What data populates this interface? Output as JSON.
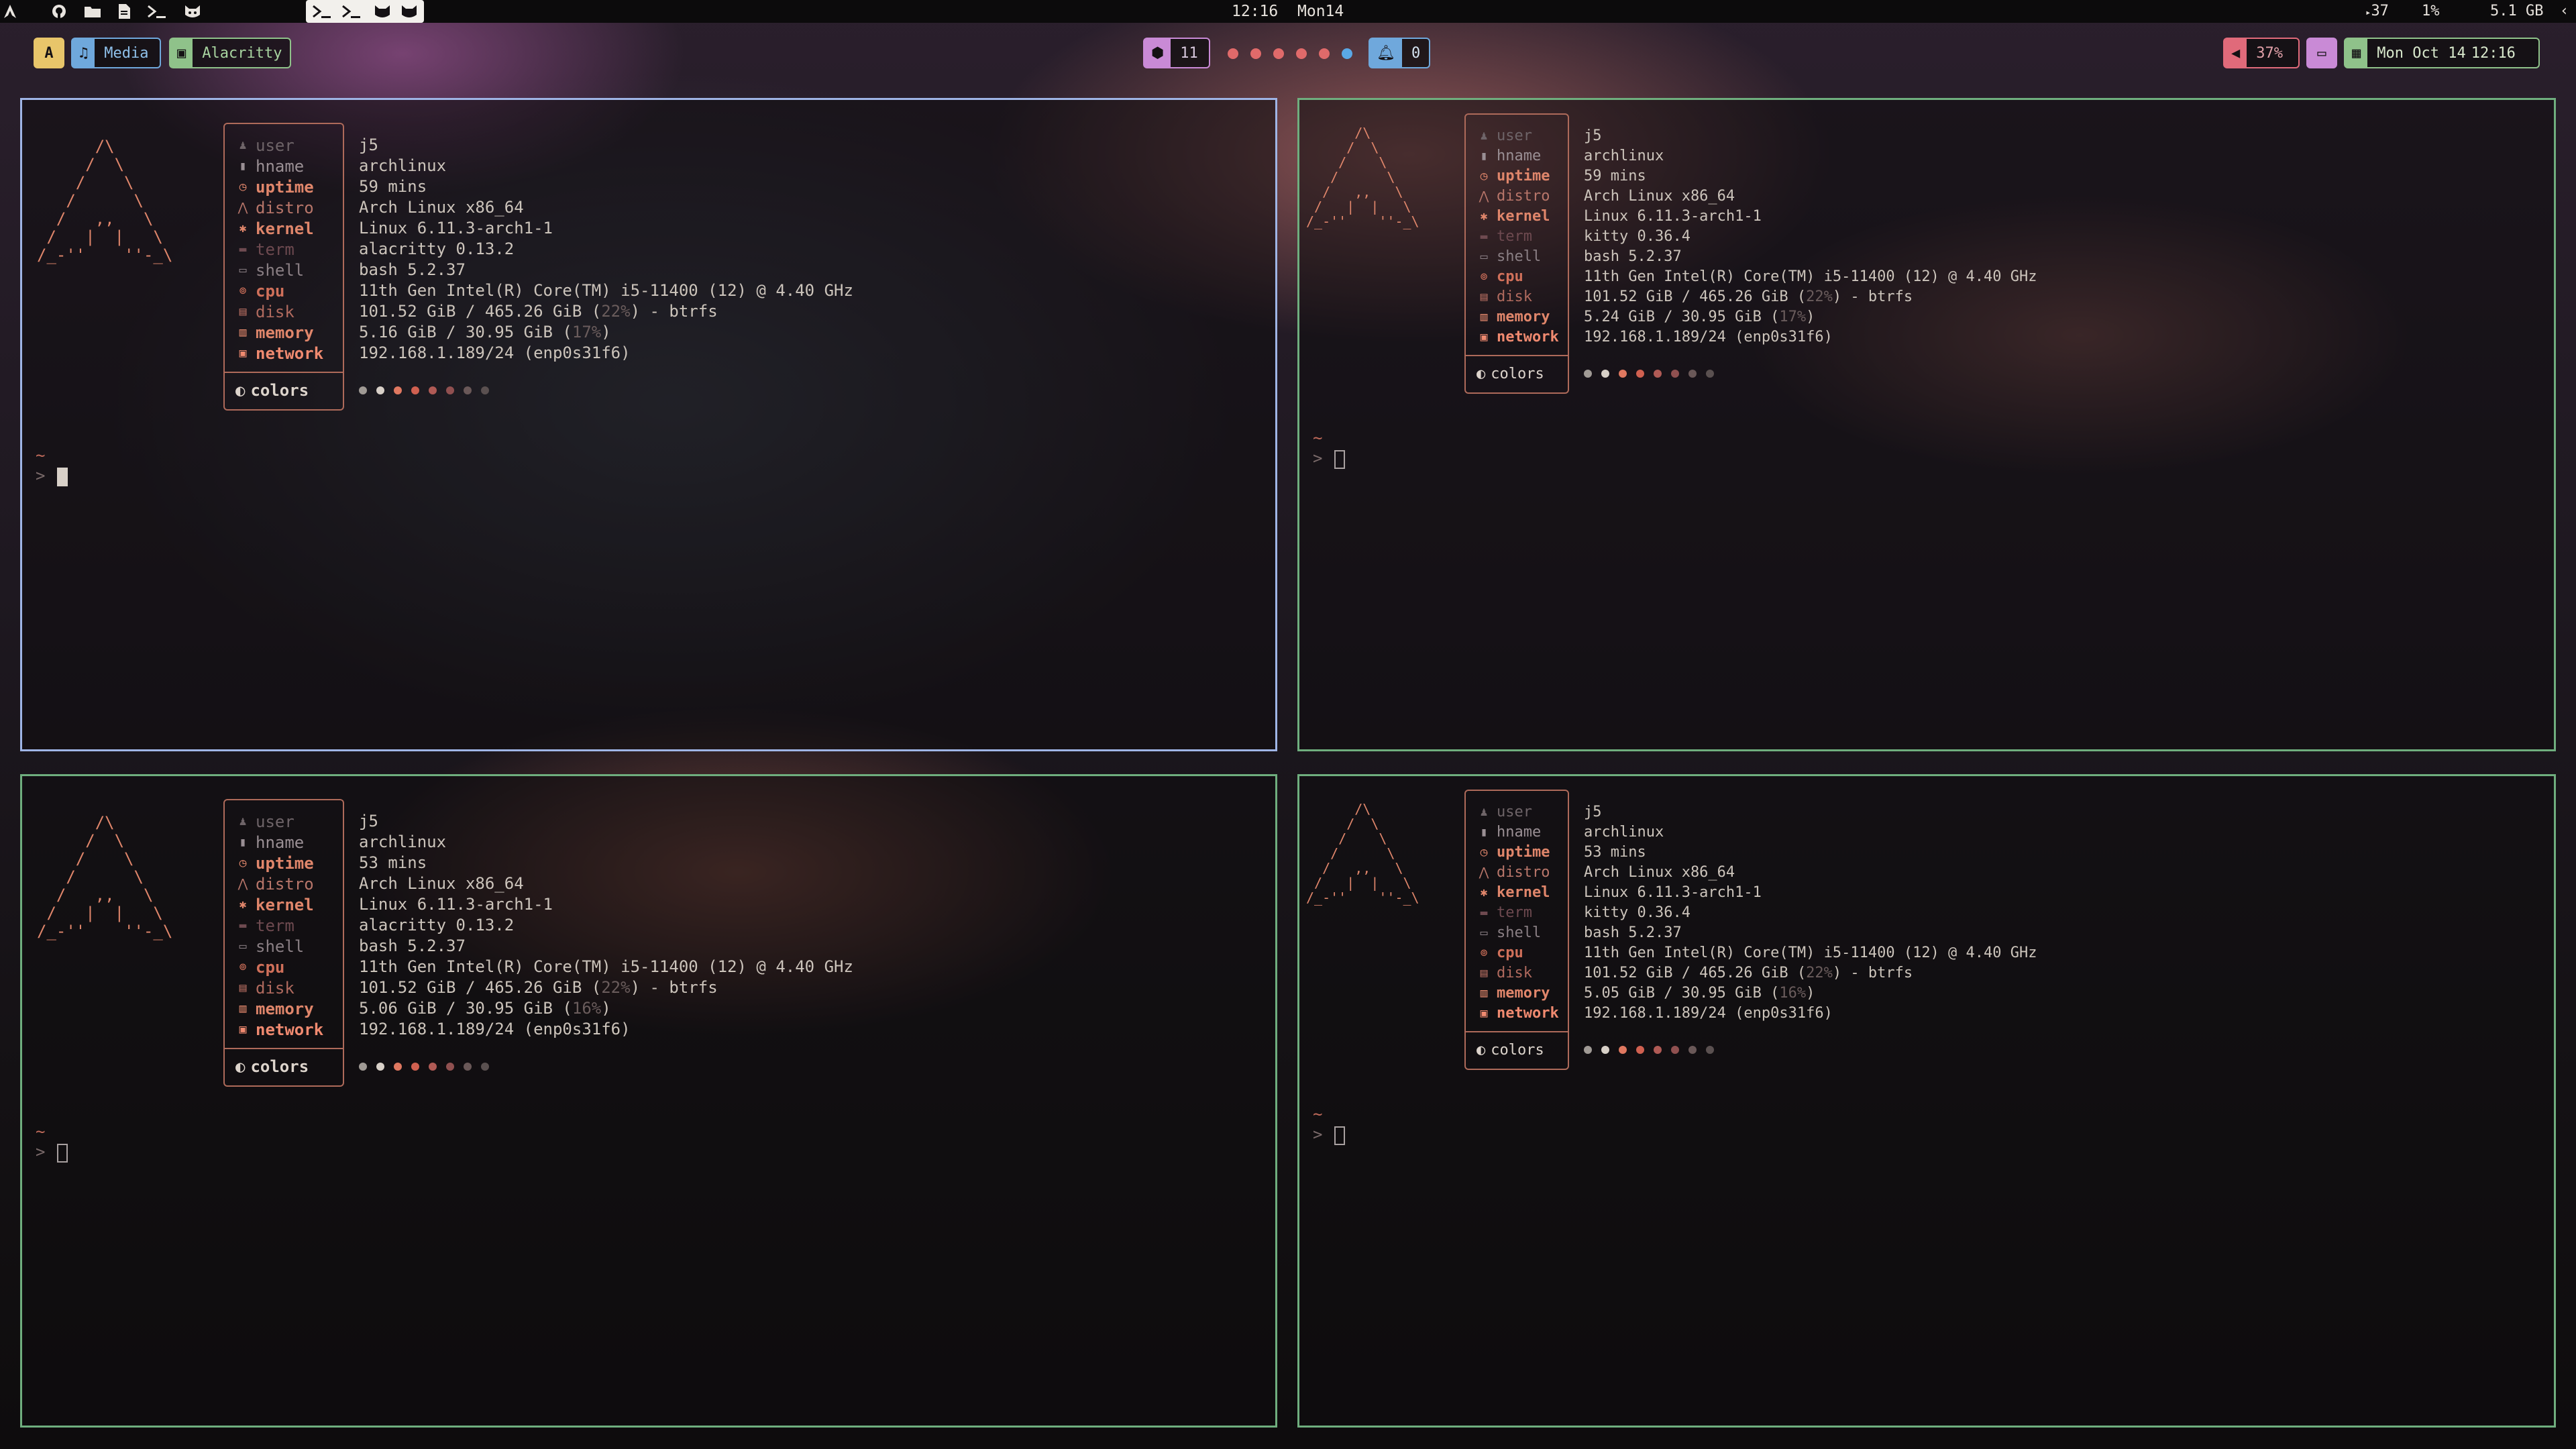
{
  "topbar": {
    "launcher_icons": [
      "arch-icon",
      "github-icon",
      "folder-icon",
      "file-icon",
      "terminal-icon",
      "cat-icon"
    ],
    "active_workspace_icons": [
      "terminal-icon",
      "terminal-icon",
      "cat-icon",
      "cat-icon"
    ],
    "center_time": "12:16",
    "center_date": "Mon14",
    "temp": "37",
    "cpu": "1%",
    "mem": "5.1 GB",
    "expand": "‹"
  },
  "modules": {
    "arch_label": "A",
    "media_label": "Media",
    "window_label": "Alacritty",
    "updates_count": "11",
    "notifications_count": "0",
    "volume": "37%",
    "clock_date": "Mon Oct 14",
    "clock_time": "12:16"
  },
  "workspace_dots": [
    "#e06a6a",
    "#e06a6a",
    "#e06a6a",
    "#e06a6a",
    "#e06a6a",
    "#5aa8e6"
  ],
  "colors": {
    "accent": "#e0866b",
    "active_border": "#9fb5e6",
    "inactive_border": "#6fae7e"
  },
  "fetch_labels": {
    "user": "user",
    "hname": "hname",
    "uptime": "uptime",
    "distro": "distro",
    "kernel": "kernel",
    "term": "term",
    "shell": "shell",
    "cpu": "cpu",
    "disk": "disk",
    "memory": "memory",
    "network": "network",
    "colors": "colors"
  },
  "logo_ascii": "      /\\\n     /  \\\n    /    \\\n   /      \\\n  /   ,,   \\\n /   |  |   \\\n/_-''    ''-_\\",
  "terminals": [
    {
      "user": "j5",
      "hname": "archlinux",
      "uptime": "59 mins",
      "distro": "Arch Linux x86_64",
      "kernel": "Linux 6.11.3-arch1-1",
      "term": "alacritty 0.13.2",
      "shell": "bash 5.2.37",
      "cpu": "11th Gen Intel(R) Core(TM) i5-11400 (12) @ 4.40 GHz",
      "disk_used": "101.52 GiB / 465.26 GiB (",
      "disk_pct": "22%",
      "disk_tail": ") - btrfs",
      "mem_used": "5.16 GiB / 30.95 GiB (",
      "mem_pct": "17%",
      "mem_tail": ")",
      "network": "192.168.1.189/24 (enp0s31f6)",
      "prompt_dir": "~",
      "prompt_sym": ">"
    },
    {
      "user": "j5",
      "hname": "archlinux",
      "uptime": "59 mins",
      "distro": "Arch Linux x86_64",
      "kernel": "Linux 6.11.3-arch1-1",
      "term": "kitty 0.36.4",
      "shell": "bash 5.2.37",
      "cpu": "11th Gen Intel(R) Core(TM) i5-11400 (12) @ 4.40 GHz",
      "disk_used": "101.52 GiB / 465.26 GiB (",
      "disk_pct": "22%",
      "disk_tail": ") - btrfs",
      "mem_used": "5.24 GiB / 30.95 GiB (",
      "mem_pct": "17%",
      "mem_tail": ")",
      "network": "192.168.1.189/24 (enp0s31f6)",
      "prompt_dir": "~",
      "prompt_sym": ">"
    },
    {
      "user": "j5",
      "hname": "archlinux",
      "uptime": "53 mins",
      "distro": "Arch Linux x86_64",
      "kernel": "Linux 6.11.3-arch1-1",
      "term": "alacritty 0.13.2",
      "shell": "bash 5.2.37",
      "cpu": "11th Gen Intel(R) Core(TM) i5-11400 (12) @ 4.40 GHz",
      "disk_used": "101.52 GiB / 465.26 GiB (",
      "disk_pct": "22%",
      "disk_tail": ") - btrfs",
      "mem_used": "5.06 GiB / 30.95 GiB (",
      "mem_pct": "16%",
      "mem_tail": ")",
      "network": "192.168.1.189/24 (enp0s31f6)",
      "prompt_dir": "~",
      "prompt_sym": ">"
    },
    {
      "user": "j5",
      "hname": "archlinux",
      "uptime": "53 mins",
      "distro": "Arch Linux x86_64",
      "kernel": "Linux 6.11.3-arch1-1",
      "term": "kitty 0.36.4",
      "shell": "bash 5.2.37",
      "cpu": "11th Gen Intel(R) Core(TM) i5-11400 (12) @ 4.40 GHz",
      "disk_used": "101.52 GiB / 465.26 GiB (",
      "disk_pct": "22%",
      "disk_tail": ") - btrfs",
      "mem_used": "5.05 GiB / 30.95 GiB (",
      "mem_pct": "16%",
      "mem_tail": ")",
      "network": "192.168.1.189/24 (enp0s31f6)",
      "prompt_dir": "~",
      "prompt_sym": ">"
    }
  ]
}
